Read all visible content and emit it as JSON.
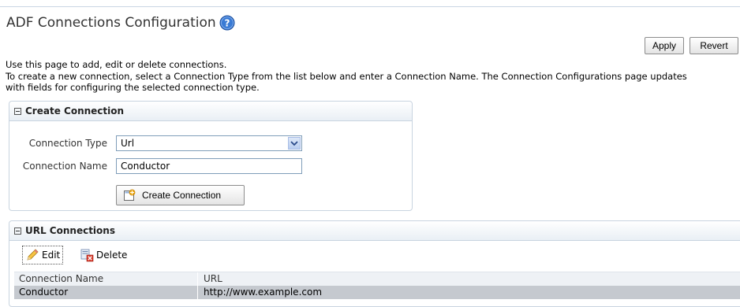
{
  "page": {
    "title": "ADF Connections Configuration",
    "help_icon": "help-circle-icon"
  },
  "actions": {
    "apply_label": "Apply",
    "revert_label": "Revert"
  },
  "description": {
    "line1": "Use this page to add, edit or delete connections.",
    "line2": "To create a new connection, select a Connection Type from the list below and enter a Connection Name. The Connection Configurations page updates",
    "line3": "with fields for configuring the selected connection type."
  },
  "create_panel": {
    "header": "Create Connection",
    "type_label": "Connection Type",
    "type_value": "Url",
    "name_label": "Connection Name",
    "name_value": "Conductor",
    "create_button": "Create Connection"
  },
  "url_panel": {
    "header": "URL Connections",
    "edit_label": "Edit",
    "delete_label": "Delete",
    "columns": [
      "Connection Name",
      "URL"
    ],
    "rows": [
      {
        "name": "Conductor",
        "url": "http://www.example.com"
      }
    ]
  },
  "colors": {
    "accent": "#2f6fc4",
    "panel_border": "#c9d4e0",
    "selected_row": "#c5c9cf"
  }
}
